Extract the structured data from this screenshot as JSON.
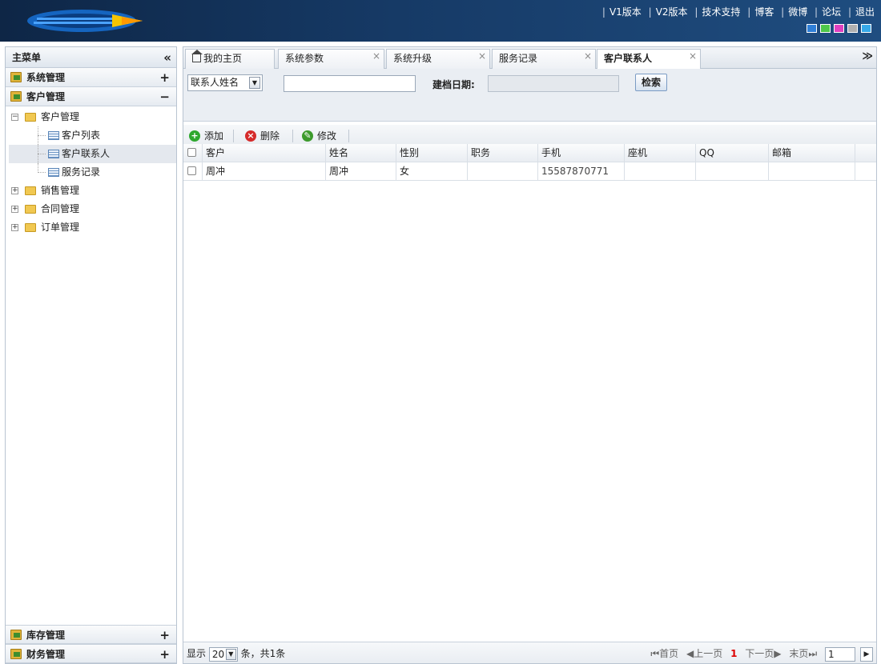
{
  "header": {
    "links": [
      "V1版本",
      "V2版本",
      "技术支持",
      "博客",
      "微博",
      "论坛",
      "退出"
    ],
    "skin_colors": [
      "#2f7fd8",
      "#4fc84a",
      "#e040c0",
      "#b0b0b0",
      "#36a8e8"
    ]
  },
  "sidebar": {
    "title": "主菜单",
    "collapse_icon": "«",
    "sections_top": [
      {
        "label": "系统管理",
        "toggle": "+"
      },
      {
        "label": "客户管理",
        "toggle": "−"
      }
    ],
    "tree": {
      "root": "客户管理",
      "leaves": [
        "客户列表",
        "客户联系人",
        "服务记录"
      ],
      "selected_leaf": "客户联系人",
      "collapsed": [
        "销售管理",
        "合同管理",
        "订单管理"
      ]
    },
    "sections_bottom": [
      {
        "label": "库存管理",
        "toggle": "+"
      },
      {
        "label": "财务管理",
        "toggle": "+"
      }
    ]
  },
  "tabs": {
    "items": [
      "我的主页",
      "系统参数",
      "系统升级",
      "服务记录",
      "客户联系人"
    ],
    "active": "客户联系人",
    "close_icon": "×",
    "menu_icon": "≫"
  },
  "search": {
    "field_select": "联系人姓名",
    "keyword_value": "",
    "date_label": "建档日期:",
    "date_value": "",
    "button": "检索"
  },
  "toolbar": {
    "add": "添加",
    "delete": "删除",
    "edit": "修改"
  },
  "grid": {
    "columns": [
      "客户",
      "姓名",
      "性别",
      "职务",
      "手机",
      "座机",
      "QQ",
      "邮箱"
    ],
    "rows": [
      [
        "周冲",
        "周冲",
        "女",
        "",
        "15587870771",
        "",
        "",
        ""
      ]
    ]
  },
  "footer": {
    "show_label": "显示",
    "page_size": "20",
    "summary": "条，共1条",
    "first": "首页",
    "prev": "上一页",
    "current_page": "1",
    "next": "下一页",
    "last": "末页",
    "page_input": "1"
  }
}
